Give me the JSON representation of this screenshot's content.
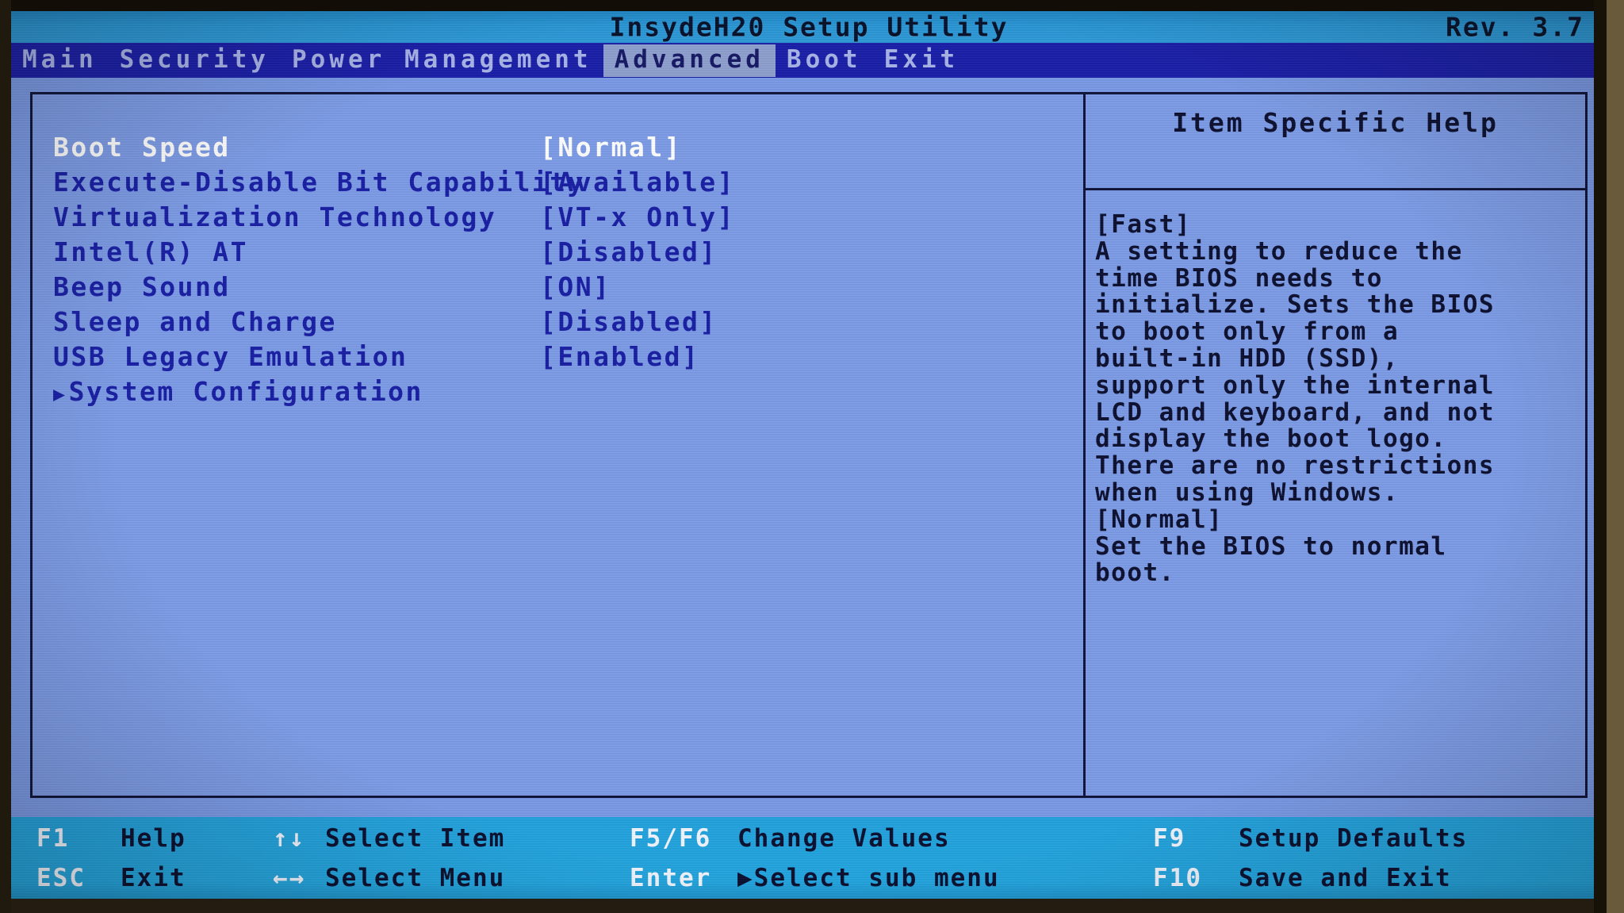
{
  "titlebar": {
    "title": "InsydeH20 Setup Utility",
    "revision": "Rev. 3.7"
  },
  "menubar": {
    "items": [
      {
        "label": "Main",
        "active": false
      },
      {
        "label": "Security",
        "active": false
      },
      {
        "label": "Power Management",
        "active": false
      },
      {
        "label": "Advanced",
        "active": true
      },
      {
        "label": "Boot",
        "active": false
      },
      {
        "label": "Exit",
        "active": false
      }
    ]
  },
  "settings": {
    "rows": [
      {
        "label": "Boot Speed",
        "value": "[Normal]",
        "selected": true,
        "submenu": false
      },
      {
        "label": "Execute-Disable Bit Capability",
        "value": "[Available]",
        "selected": false,
        "submenu": false
      },
      {
        "label": "Virtualization Technology",
        "value": "[VT-x Only]",
        "selected": false,
        "submenu": false
      },
      {
        "label": "Intel(R) AT",
        "value": "[Disabled]",
        "selected": false,
        "submenu": false
      },
      {
        "label": "Beep Sound",
        "value": "[ON]",
        "selected": false,
        "submenu": false
      },
      {
        "label": "Sleep and Charge",
        "value": "[Disabled]",
        "selected": false,
        "submenu": false
      },
      {
        "label": "USB Legacy Emulation",
        "value": "[Enabled]",
        "selected": false,
        "submenu": false
      },
      {
        "label": "System Configuration",
        "value": "",
        "selected": false,
        "submenu": true
      }
    ],
    "submenu_marker": "▶"
  },
  "help": {
    "title": "Item Specific Help",
    "lines": [
      "[Fast]",
      "A setting to reduce the",
      "time BIOS needs to",
      "initialize. Sets the BIOS",
      "to boot only from a",
      "built-in HDD (SSD),",
      "support only the internal",
      "LCD and keyboard, and not",
      "display the boot logo.",
      "There are no restrictions",
      "when using Windows.",
      "[Normal]",
      "Set the BIOS to normal",
      "boot."
    ]
  },
  "footer": {
    "columns": [
      {
        "rows": [
          {
            "key": "F1",
            "desc": "Help"
          },
          {
            "key": "ESC",
            "desc": "Exit"
          }
        ]
      },
      {
        "rows": [
          {
            "key": "↑↓",
            "desc": "Select Item"
          },
          {
            "key": "←→",
            "desc": "Select Menu"
          }
        ]
      },
      {
        "rows": [
          {
            "key": "F5/F6",
            "desc": "Change Values"
          },
          {
            "key": "Enter",
            "desc": "▶Select sub menu"
          }
        ]
      },
      {
        "rows": [
          {
            "key": "F9",
            "desc": "Setup Defaults"
          },
          {
            "key": "F10",
            "desc": "Save and Exit"
          }
        ]
      }
    ]
  },
  "colors": {
    "screen_bg": "#7d9ce6",
    "titlebar_bg": "#2a96d4",
    "menubar_bg": "#1b1fa8",
    "menu_active_bg": "#8fa0cf",
    "text_navy": "#1a1fa4",
    "text_dark": "#0d1130",
    "text_selected": "#ffffff",
    "footer_bg": "#23a6e0",
    "frame_border": "#10143a"
  }
}
